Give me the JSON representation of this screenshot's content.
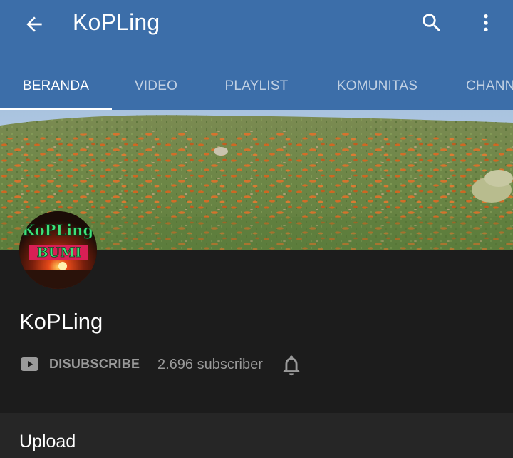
{
  "appbar": {
    "title": "KoPLing",
    "back_icon": "arrow-back-icon",
    "search_icon": "search-icon",
    "menu_icon": "more-vert-icon",
    "background": "#3c6ea9"
  },
  "tabs": [
    {
      "label": "BERANDA",
      "active": true
    },
    {
      "label": "VIDEO",
      "active": false
    },
    {
      "label": "PLAYLIST",
      "active": false
    },
    {
      "label": "KOMUNITAS",
      "active": false
    },
    {
      "label": "CHANNEL",
      "active": false
    }
  ],
  "avatar": {
    "line1": "KoPLing",
    "line2": "BUMI"
  },
  "channel": {
    "name": "KoPLing",
    "unsubscribe_label": "DISUBSCRIBE",
    "subscriber_count": "2.696 subscriber",
    "yt_icon": "youtube-icon",
    "bell_icon": "notification-bell-icon"
  },
  "section": {
    "title": "Upload"
  }
}
